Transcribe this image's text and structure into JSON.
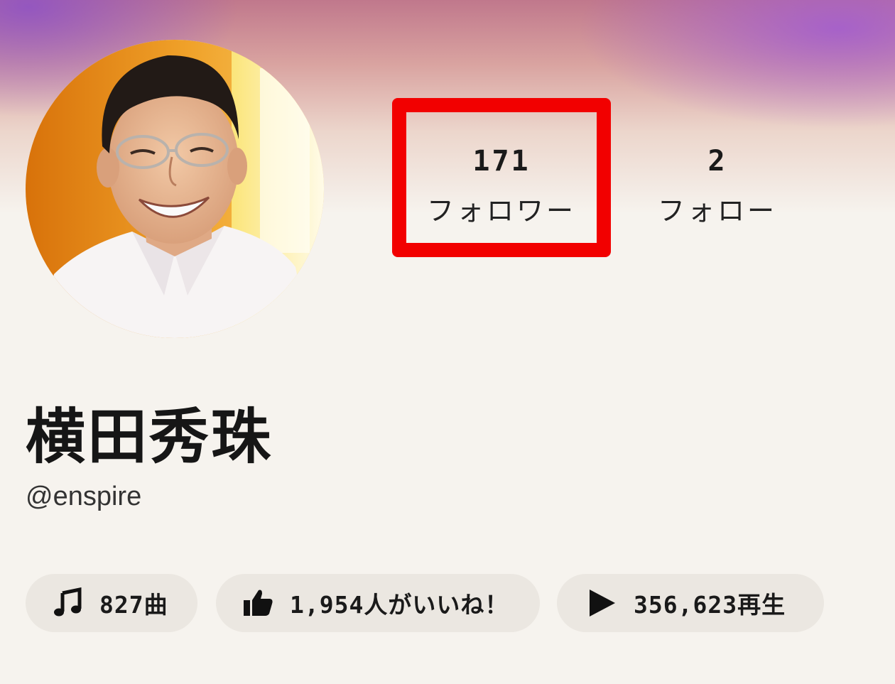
{
  "profile": {
    "display_name": "横田秀珠",
    "handle": "@enspire",
    "avatar_icon": "profile-photo"
  },
  "stats": {
    "followers": {
      "value": "171",
      "label": "フォロワー",
      "highlighted": true,
      "highlight_color": "#f20000"
    },
    "following": {
      "value": "2",
      "label": "フォロー"
    }
  },
  "badges": [
    {
      "icon": "music-note-icon",
      "text": "827曲"
    },
    {
      "icon": "thumbs-up-icon",
      "text": "1,954人がいいね！"
    },
    {
      "icon": "play-icon",
      "text": "356,623再生"
    }
  ],
  "colors": {
    "background": "#f6f3ee",
    "pill_background": "#ebe7e1",
    "text": "#1a1a1a"
  }
}
